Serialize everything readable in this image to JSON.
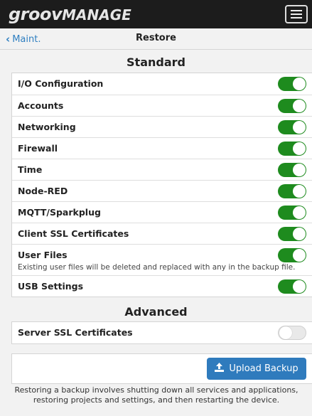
{
  "app": {
    "logo_part1": "groov",
    "logo_part2": "MANAGE"
  },
  "nav": {
    "back_label": "Maint.",
    "title": "Restore"
  },
  "standard": {
    "heading": "Standard",
    "items": [
      {
        "label": "I/O Configuration",
        "on": true
      },
      {
        "label": "Accounts",
        "on": true
      },
      {
        "label": "Networking",
        "on": true
      },
      {
        "label": "Firewall",
        "on": true
      },
      {
        "label": "Time",
        "on": true
      },
      {
        "label": "Node-RED",
        "on": true
      },
      {
        "label": "MQTT/Sparkplug",
        "on": true
      },
      {
        "label": "Client SSL Certificates",
        "on": true
      },
      {
        "label": "User Files",
        "on": true,
        "description": "Existing user files will be deleted and replaced with any in the backup file."
      },
      {
        "label": "USB Settings",
        "on": true
      }
    ]
  },
  "advanced": {
    "heading": "Advanced",
    "items": [
      {
        "label": "Server SSL Certificates",
        "on": false
      }
    ]
  },
  "upload": {
    "button_label": "Upload Backup",
    "note": "Restoring a backup involves shutting down all services and applications, restoring projects and settings, and then restarting the device."
  },
  "colors": {
    "toggle_on": "#1e8b1e",
    "primary_button": "#2f7bbd",
    "link": "#2f7fc1",
    "topbar": "#1c1c1c"
  }
}
